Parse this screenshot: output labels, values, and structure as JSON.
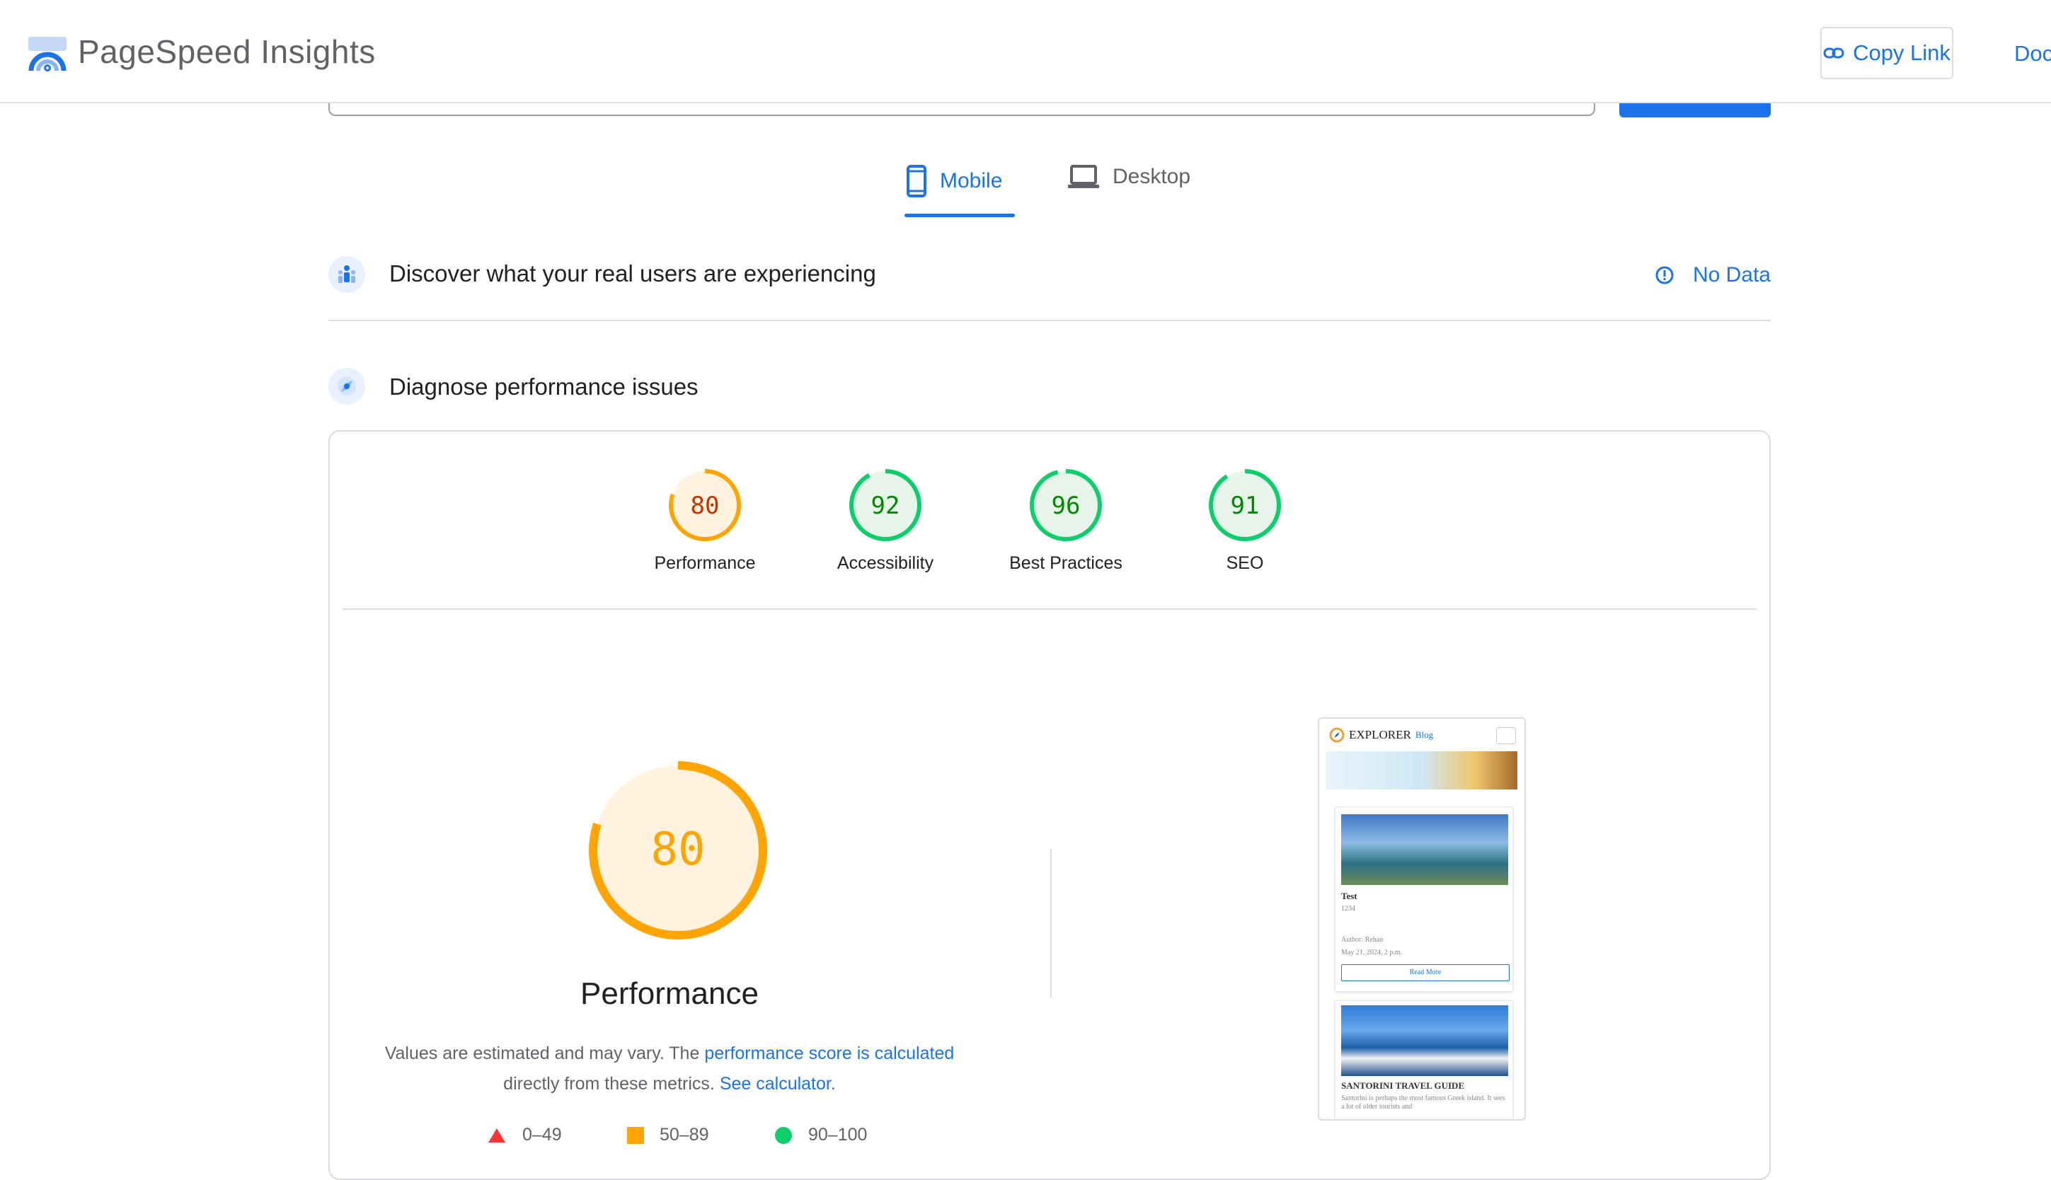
{
  "header": {
    "app_title": "PageSpeed Insights",
    "copy_link_label": "Copy Link",
    "docs_label": "Doc"
  },
  "tabs": [
    {
      "label": "Mobile",
      "icon": "smartphone-icon",
      "selected": true
    },
    {
      "label": "Desktop",
      "icon": "laptop-icon",
      "selected": false
    }
  ],
  "field_data": {
    "title": "Discover what your real users are experiencing",
    "status": "No Data"
  },
  "lab_data": {
    "title": "Diagnose performance issues"
  },
  "scores": [
    {
      "label": "Performance",
      "value": "80",
      "score": 80,
      "color": "#ffa400",
      "text_color": "#c33300",
      "bg": "#fff3e0"
    },
    {
      "label": "Accessibility",
      "value": "92",
      "score": 92,
      "color": "#0cce6b",
      "text_color": "#008800",
      "bg": "#e6f4ea"
    },
    {
      "label": "Best Practices",
      "value": "96",
      "score": 96,
      "color": "#0cce6b",
      "text_color": "#008800",
      "bg": "#e6f4ea"
    },
    {
      "label": "SEO",
      "value": "91",
      "score": 91,
      "color": "#0cce6b",
      "text_color": "#008800",
      "bg": "#e6f4ea"
    }
  ],
  "performance": {
    "score": "80",
    "title": "Performance",
    "desc_prefix": "Values are estimated and may vary. The ",
    "desc_link": "performance score is calculated",
    "desc_mid": "directly from these metrics. ",
    "desc_link2": "See calculator.",
    "color": "#ffa400"
  },
  "legend": [
    {
      "range": "0–49",
      "shape": "triangle",
      "color": "#ff3333"
    },
    {
      "range": "50–89",
      "shape": "square",
      "color": "#ffa400"
    },
    {
      "range": "90–100",
      "shape": "circle",
      "color": "#0cce6b"
    }
  ],
  "screenshot": {
    "site_name": "EXPLORER",
    "site_suffix": "Blog",
    "post1_title": "Test",
    "post1_sub": "1234",
    "post1_author": "Author: Rehan",
    "post1_date": "May 21, 2024, 2 p.m.",
    "read_more": "Read More",
    "post2_title": "SANTORINI TRAVEL GUIDE",
    "post2_excerpt": "Santorini is perhaps the most famous Greek island. It sees a lot of older tourists and"
  }
}
